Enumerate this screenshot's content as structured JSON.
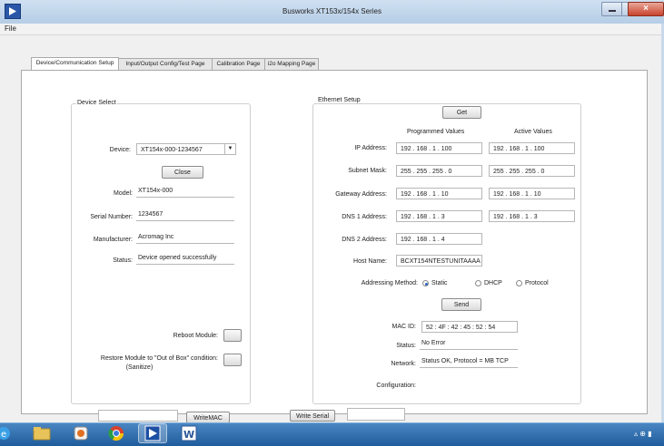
{
  "window": {
    "title": "Busworks XT153x/154x Series",
    "close_glyph": "×"
  },
  "menu": {
    "file": "File"
  },
  "tabs": [
    {
      "label": "Device/Communication Setup"
    },
    {
      "label": "Input/Output Config/Test Page"
    },
    {
      "label": "Calibration Page"
    },
    {
      "label": "i2o Mapping Page"
    }
  ],
  "device_select": {
    "title": "Device Select",
    "device_label": "Device:",
    "device_value": "XT154x-000-1234567",
    "close_button": "Close",
    "model_label": "Model:",
    "model_value": "XT154x-000",
    "serial_label": "Serial Number:",
    "serial_value": "1234567",
    "manufacturer_label": "Manufacturer:",
    "manufacturer_value": "Acromag Inc",
    "status_label": "Status:",
    "status_value": "Device opened successfully",
    "reboot_label": "Reboot Module:",
    "restore_label_line1": "Restore Module to \"Out of Box\" condition:",
    "restore_label_line2": "(Sanitize)"
  },
  "ethernet": {
    "title": "Ethernet Setup",
    "get_button": "Get",
    "programmed_header": "Programmed Values",
    "active_header": "Active Values",
    "rows": [
      {
        "label": "IP Address:",
        "programmed": "192  .  168  .   1   .  100",
        "active": "192  .  168  .   1   .  100"
      },
      {
        "label": "Subnet Mask:",
        "programmed": "255  .  255  .  255  .   0",
        "active": "255  .  255  .  255  .   0"
      },
      {
        "label": "Gateway Address:",
        "programmed": "192  .  168  .   1   .   10",
        "active": "192  .  168  .   1   .   10"
      },
      {
        "label": "DNS 1 Address:",
        "programmed": "192  .  168  .   1   .   3",
        "active": "192  .  168  .   1   .   3"
      },
      {
        "label": "DNS 2 Address:",
        "programmed": "192  .  168  .   1   .   4",
        "active": ""
      }
    ],
    "host_label": "Host Name:",
    "host_value": "BCXT154NTESTUNITAAAA",
    "addressing_label": "Addressing Method:",
    "addressing_options": [
      "Static",
      "DHCP",
      "Protocol"
    ],
    "addressing_selected": "Static",
    "send_button": "Send",
    "mac_label": "MAC ID:",
    "mac_value": "52 : 4F : 42 : 45 : 52 : 54",
    "status_label": "Status:",
    "status_value": "No Error",
    "network_label": "Network:",
    "network_value": "Status OK, Protocol = MB TCP",
    "configuration_label": "Configuration:"
  },
  "bottom": {
    "mac_input_value": "",
    "write_mac_button": "WriteMAC",
    "write_serial_button": "Write Serial",
    "serial_input_value": ""
  },
  "taskbar": {
    "items": [
      "ie-icon",
      "folder-icon",
      "media-player-icon",
      "chrome-icon",
      "busworks-app-icon",
      "word-icon"
    ],
    "tray_glyphs": "▵ ⊕ ▮"
  }
}
